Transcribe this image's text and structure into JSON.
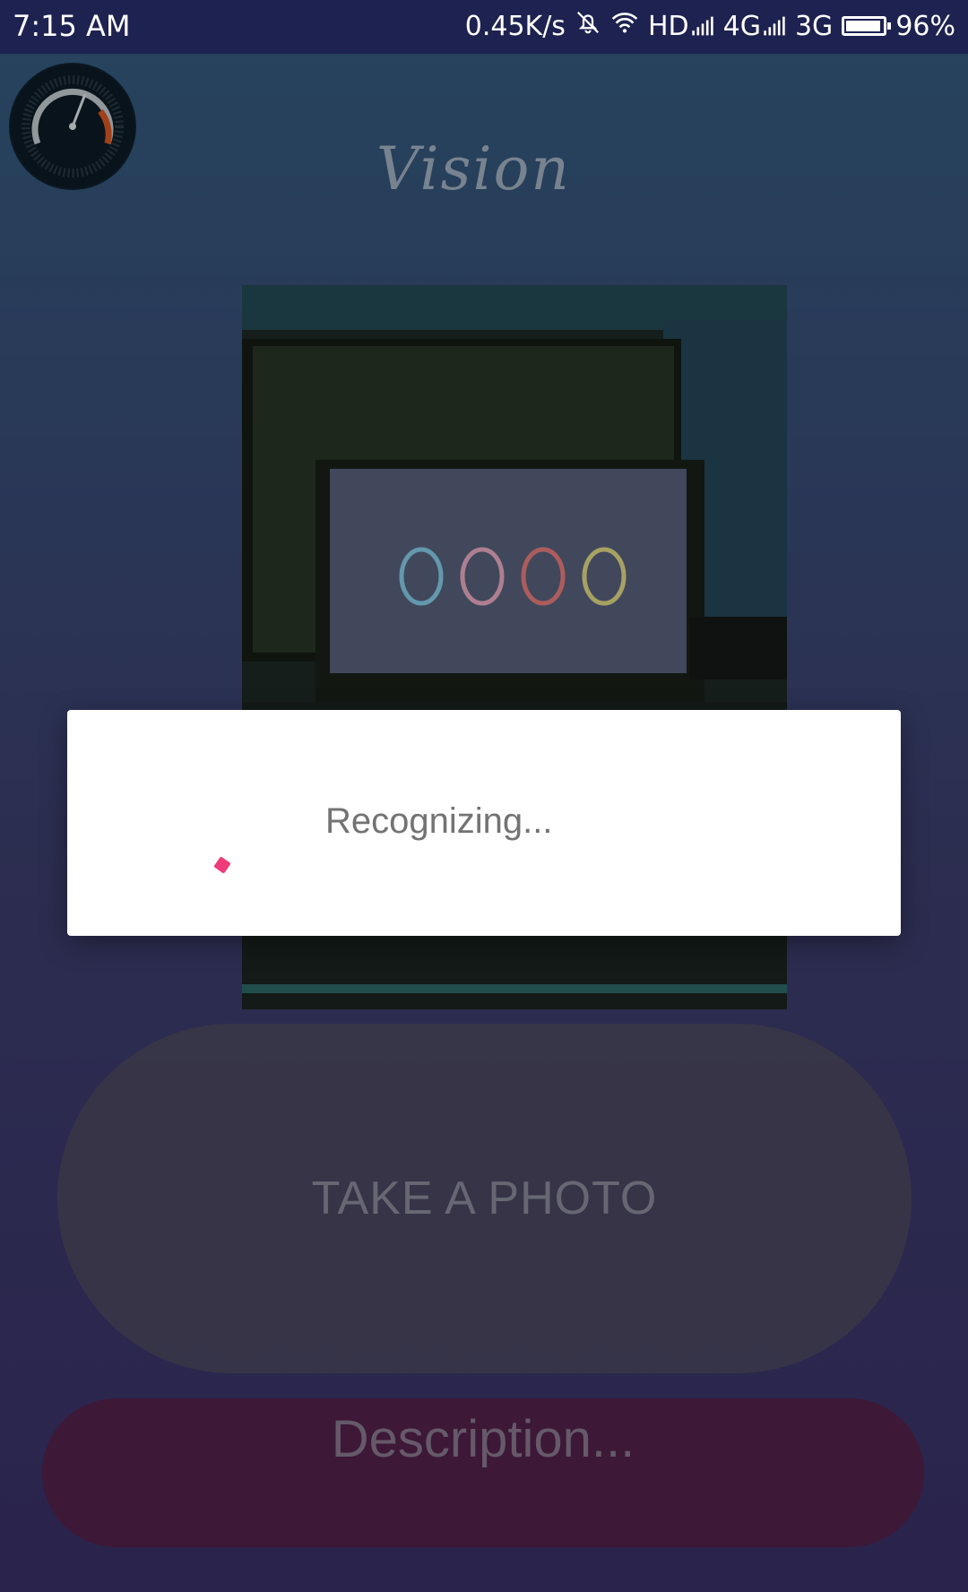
{
  "status_bar": {
    "time": "7:15 AM",
    "speed": "0.45K/s",
    "hd": "HD",
    "net1": "4G",
    "net2": "3G",
    "battery": "96%",
    "battery_level": 0.96
  },
  "app": {
    "logo_text": "Vision"
  },
  "buttons": {
    "take_photo": "TAKE A PHOTO",
    "description_placeholder": "Description..."
  },
  "dialog": {
    "message": "Recognizing..."
  },
  "colors": {
    "status_bar": "#1e2250",
    "spinner": "#ee3b7a",
    "description_button": "#55224d",
    "take_photo_button": "#504c64"
  },
  "icons": [
    "bell-off-icon",
    "wifi-icon",
    "signal-icon",
    "battery-icon",
    "speedometer-icon",
    "spinner-icon"
  ]
}
